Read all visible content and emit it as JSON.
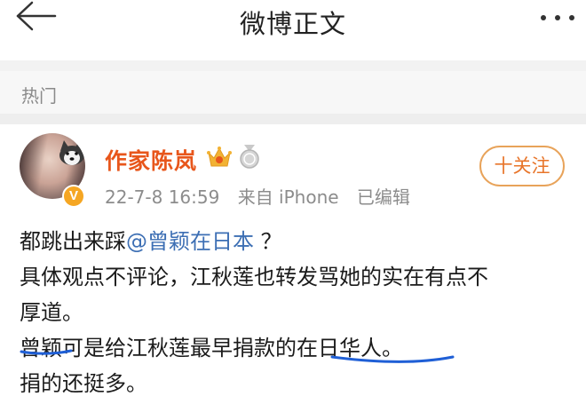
{
  "navbar": {
    "title": "微博正文",
    "back_icon": "back-arrow-icon",
    "more_icon": "more-dots-icon"
  },
  "section": {
    "hot_label": "热门"
  },
  "post": {
    "username": "作家陈岚",
    "verified_badge": "V",
    "time": "22-7-8 16:59",
    "source": "来自 iPhone",
    "edited": "已编辑",
    "follow_label": "十关注",
    "body": {
      "line1_prefix": "都跳出来踩",
      "line1_mention": "@曾颖在日本",
      "line1_suffix": " ？",
      "line2": "具体观点不评论，江秋莲也转发骂她的实在有点不",
      "line3": "厚道。",
      "line4": "曾颖可是给江秋莲最早捐款的在日华人。",
      "line5": "捐的还挺多。"
    },
    "annotation_color": "#1f5fd6",
    "username_color": "#e8561b",
    "mention_color": "#3d6fb4"
  }
}
